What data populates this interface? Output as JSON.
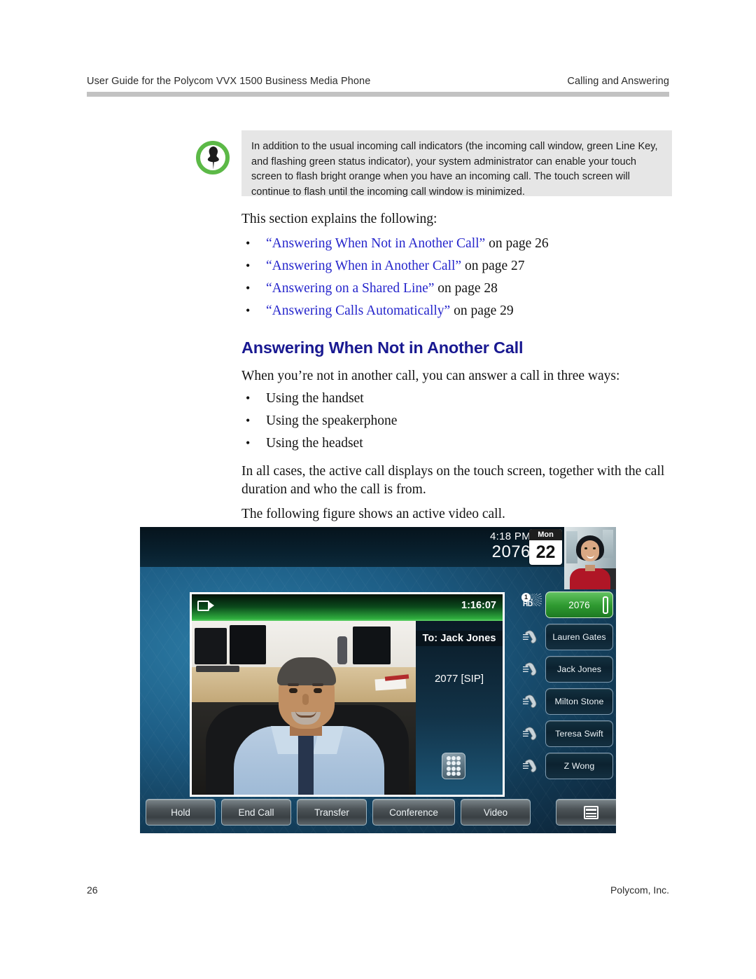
{
  "header": {
    "left": "User Guide for the Polycom VVX 1500 Business Media Phone",
    "right": "Calling and Answering"
  },
  "note": {
    "icon": "pushpin-icon",
    "text": "In addition to the usual incoming call indicators (the incoming call window, green Line Key, and flashing green status indicator), your system administrator can enable your touch screen to flash bright orange when you have an incoming call. The touch screen will continue to flash until the incoming call window is minimized."
  },
  "body": {
    "intro": "This section explains the following:",
    "xrefs": [
      {
        "link": "“Answering When Not in Another Call”",
        "suffix": " on page 26"
      },
      {
        "link": "“Answering When in Another Call”",
        "suffix": " on page 27"
      },
      {
        "link": "“Answering on a Shared Line”",
        "suffix": " on page 28"
      },
      {
        "link": "“Answering Calls Automatically”",
        "suffix": " on page 29"
      }
    ],
    "section_title": "Answering When Not in Another Call",
    "para1": "When you’re not in another call, you can answer a call in three ways:",
    "ways": [
      "Using the handset",
      "Using the speakerphone",
      "Using the headset"
    ],
    "para2": "In all cases, the active call displays on the touch screen, together with the call duration and who the call is from.",
    "para3": "The following figure shows an active video call."
  },
  "phone": {
    "status": {
      "time": "4:18 PM",
      "extension": "2076",
      "calendar_dow": "Mon",
      "calendar_day": "22"
    },
    "call_window": {
      "timer": "1:16:07",
      "to_label": "To: Jack Jones",
      "number": "2077 [SIP]"
    },
    "line_keys": [
      {
        "label": "2076",
        "active": true
      },
      {
        "label": "Lauren Gates",
        "active": false
      },
      {
        "label": "Jack Jones",
        "active": false
      },
      {
        "label": "Milton Stone",
        "active": false
      },
      {
        "label": "Teresa Swift",
        "active": false
      },
      {
        "label": "Z Wong",
        "active": false
      }
    ],
    "call_badge": {
      "count": "1",
      "quality": "HD"
    },
    "soft_keys": [
      "Hold",
      "End Call",
      "Transfer",
      "Conference",
      "Video"
    ]
  },
  "footer": {
    "page_number": "26",
    "company": "Polycom, Inc."
  },
  "colors": {
    "heading_blue": "#191991",
    "link_blue": "#2626cc",
    "note_bg": "#e6e6e6",
    "rule_gray": "#c2c2c2",
    "line_key_green": "#2f9a31"
  }
}
